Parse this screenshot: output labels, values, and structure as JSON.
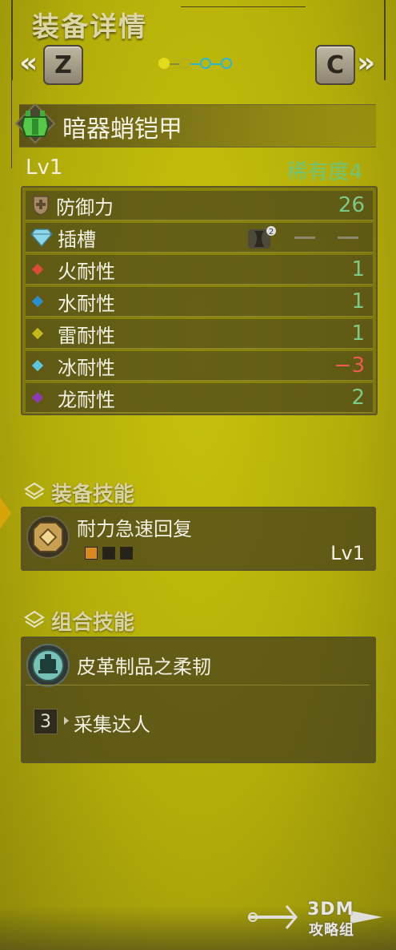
{
  "header": {
    "title": "装备详情",
    "prev_key": "Z",
    "next_key": "C",
    "prev_arrow": "«",
    "next_arrow": "»",
    "page_dots": {
      "total": 4,
      "active": 1,
      "colors": [
        "#e4dc1a",
        "#b5ae24",
        "#2bb7d4",
        "#2bb7d4"
      ]
    }
  },
  "armor": {
    "name": "暗器蛸铠甲",
    "icon": "chest-armor-icon",
    "level": "Lv1",
    "rarity": "稀有度4"
  },
  "stats": [
    {
      "key": "defense",
      "label": "防御力",
      "value": "26",
      "icon": "shield-icon"
    },
    {
      "key": "slots",
      "label": "插槽",
      "value": "",
      "icon": "diamond-icon",
      "slot_decoration": "decoration-slot-2-icon",
      "empty_slots": [
        "—",
        "—"
      ]
    },
    {
      "key": "fire",
      "label": "火耐性",
      "value": "1",
      "icon": "fire-element-icon",
      "color": "#d84a3a"
    },
    {
      "key": "water",
      "label": "水耐性",
      "value": "1",
      "icon": "water-element-icon",
      "color": "#2a8fd0"
    },
    {
      "key": "thunder",
      "label": "雷耐性",
      "value": "1",
      "icon": "thunder-element-icon",
      "color": "#c4b81a"
    },
    {
      "key": "ice",
      "label": "冰耐性",
      "value": "−3",
      "icon": "ice-element-icon",
      "color": "#5fc6dc",
      "negative": true
    },
    {
      "key": "dragon",
      "label": "龙耐性",
      "value": "2",
      "icon": "dragon-element-icon",
      "color": "#8c3cb8"
    }
  ],
  "equip_skills": {
    "section_title": "装备技能",
    "items": [
      {
        "name": "耐力急速回复",
        "level": "Lv1",
        "filled": 1,
        "max": 3,
        "icon": "stamina-skill-icon"
      }
    ]
  },
  "set_skills": {
    "section_title": "组合技能",
    "set_name": "皮革制品之柔韧",
    "icon": "set-bonus-icon",
    "bonuses": [
      {
        "pieces": "3",
        "name": "采集达人"
      }
    ]
  },
  "watermark": {
    "line1": "3DM",
    "line2": "攻略组"
  }
}
